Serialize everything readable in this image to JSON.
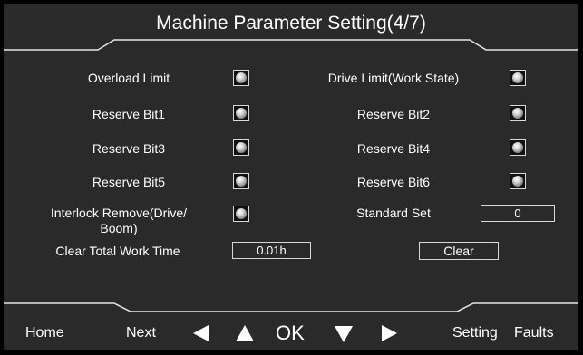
{
  "title": "Machine Parameter Setting(4/7)",
  "params": {
    "overload_limit": "Overload Limit",
    "drive_limit": "Drive Limit(Work State)",
    "reserve_bit1": "Reserve Bit1",
    "reserve_bit2": "Reserve Bit2",
    "reserve_bit3": "Reserve Bit3",
    "reserve_bit4": "Reserve Bit4",
    "reserve_bit5": "Reserve Bit5",
    "reserve_bit6": "Reserve Bit6",
    "interlock_line1": "Interlock Remove(Drive/",
    "interlock_line2": "Boom)",
    "standard_set": "Standard Set",
    "standard_set_value": "0",
    "clear_total_work_time": "Clear Total Work Time",
    "work_time_value": "0.01h",
    "clear_button": "Clear"
  },
  "nav": {
    "home": "Home",
    "next": "Next",
    "ok": "OK",
    "setting": "Setting",
    "faults": "Faults"
  },
  "icons": {
    "left": "triangle-left-icon",
    "up": "triangle-up-icon",
    "down": "triangle-down-icon",
    "right": "triangle-right-icon"
  }
}
